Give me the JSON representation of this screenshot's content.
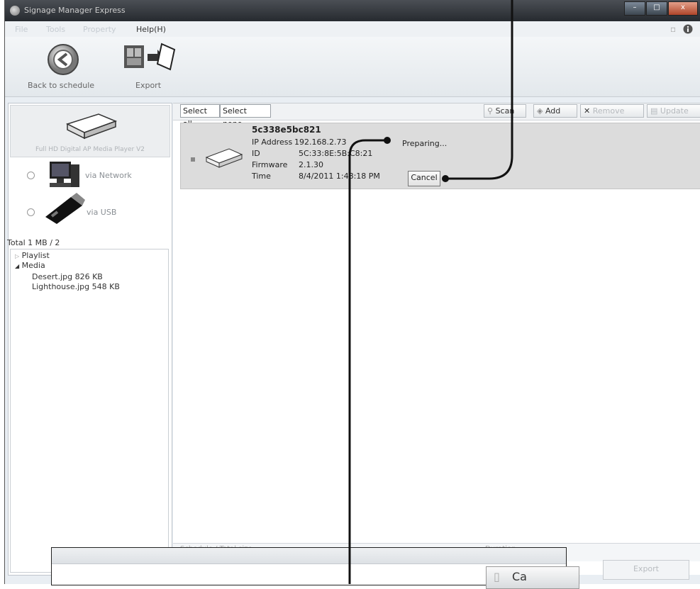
{
  "window": {
    "title": "Signage Manager Express",
    "controls": [
      "–",
      "□",
      "x"
    ]
  },
  "menu": {
    "file": "File",
    "tools": "Tools",
    "property": "Property",
    "help": "Help(H)",
    "info_icon": "info-icon"
  },
  "ribbon": {
    "back_label": "Back to schedule",
    "export_label": "Export"
  },
  "left": {
    "device_name": "Full HD Digital AP Media Player V2",
    "network_label": "via Network",
    "usb_label": "via USB",
    "totals": "Total 1 MB / 2",
    "tree": {
      "playlist": "Playlist",
      "media": "Media",
      "files": [
        "Desert.jpg 826 KB",
        "Lighthouse.jpg 548 KB"
      ]
    }
  },
  "toolbar": {
    "select_all": "Select all",
    "select_none": "Select none",
    "scan": "Scan",
    "add": "Add",
    "remove": "Remove",
    "update": "Update"
  },
  "device": {
    "name": "5c338e5bc821",
    "ip_label": "IP Address",
    "ip": "192.168.2.73",
    "id_label": "ID",
    "id": "5C:33:8E:5B:C8:21",
    "fw_label": "Firmware",
    "fw": "2.1.30",
    "time_label": "Time",
    "time": "8/4/2011 1:48:18 PM",
    "status": "Preparing...",
    "cancel": "Cancel"
  },
  "status_bar": {
    "left": "Schedule / Total  size",
    "right": "Duration"
  },
  "footer": {
    "export_button": "Export"
  },
  "overlay": {
    "button_label": "Ca"
  }
}
